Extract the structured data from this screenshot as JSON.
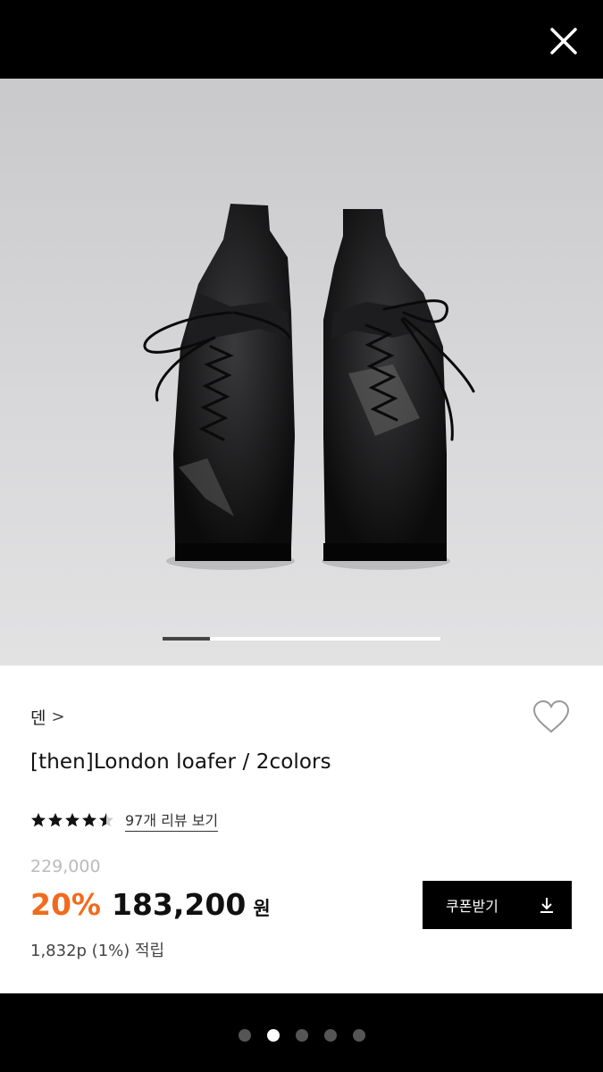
{
  "header": {
    "close_icon": "close-icon"
  },
  "gallery": {
    "progress": 0.17
  },
  "product": {
    "brand": "덴",
    "brand_chevron": ">",
    "title": "[then]London loafer / 2colors",
    "rating": 4.5,
    "review_link": "97개 리뷰 보기",
    "original_price": "229,000",
    "discount": "20%",
    "price": "183,200",
    "currency": "원",
    "points": "1,832p (1%) 적립"
  },
  "coupon": {
    "label": "쿠폰받기",
    "icon": "download-icon"
  },
  "pagination": {
    "count": 5,
    "active_index": 1
  },
  "colors": {
    "accent": "#f06b1e",
    "background": "#000000"
  }
}
